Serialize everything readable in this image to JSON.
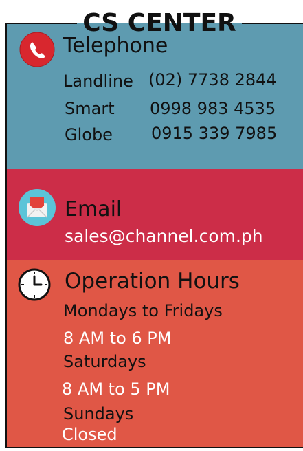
{
  "header": {
    "title": "CS CENTER"
  },
  "telephone": {
    "title": "Telephone",
    "icon": "phone-icon",
    "rows": [
      {
        "label": "Landline",
        "value": "(02) 7738 2844"
      },
      {
        "label": "Smart",
        "value": "0998 983 4535"
      },
      {
        "label": "Globe",
        "value": "0915 339 7985"
      }
    ]
  },
  "email": {
    "title": "Email",
    "icon": "mail-icon",
    "address": "sales@channel.com.ph"
  },
  "hours": {
    "title": "Operation Hours",
    "icon": "clock-icon",
    "lines": [
      {
        "text": "Mondays to Fridays"
      },
      {
        "text": "8 AM to 6 PM"
      },
      {
        "text": "Saturdays"
      },
      {
        "text": "8 AM to 5 PM"
      },
      {
        "text": "Sundays"
      },
      {
        "text": "Closed"
      }
    ]
  },
  "colors": {
    "telephone_bg": "#5e9bb0",
    "email_bg": "#cc2d48",
    "hours_bg": "#e05746",
    "phone_icon": "#d8272e",
    "mail_icon_bg": "#5bc4d8"
  }
}
